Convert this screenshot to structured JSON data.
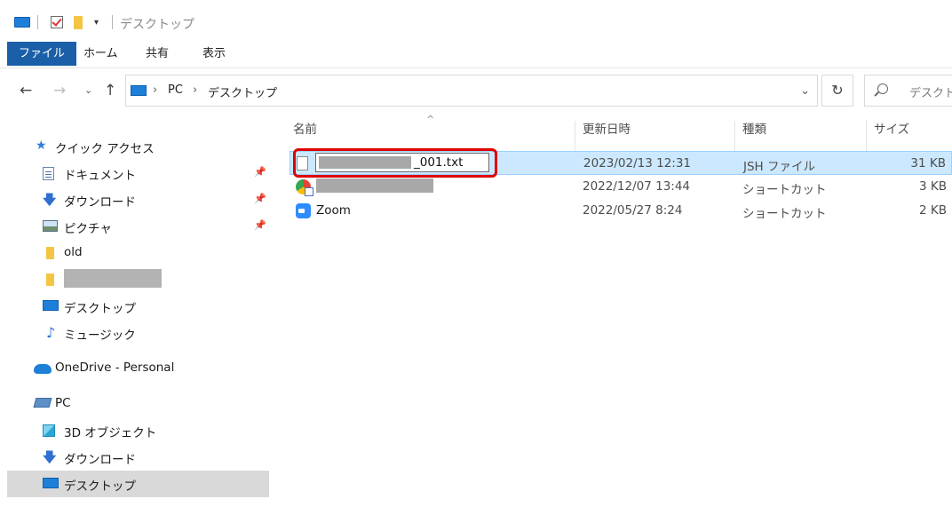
{
  "window": {
    "title": "デスクトップ"
  },
  "quick_access_toolbar": {
    "dropdown_glyph": "▾"
  },
  "ribbon": {
    "tabs": [
      "ファイル",
      "ホーム",
      "共有",
      "表示"
    ]
  },
  "nav": {
    "back": "←",
    "forward": "→",
    "recent": "⌄",
    "up": "↑",
    "breadcrumb": [
      "PC",
      "デスクトップ"
    ],
    "chevron": "›",
    "address_dropdown": "⌄",
    "refresh": "↻",
    "search_placeholder": "デスクトッ"
  },
  "navpane": {
    "quick_access": "クイック アクセス",
    "items": [
      {
        "label": "ドキュメント",
        "icon": "document-icon",
        "pinned": true
      },
      {
        "label": "ダウンロード",
        "icon": "download-icon",
        "pinned": true
      },
      {
        "label": "ピクチャ",
        "icon": "pictures-icon",
        "pinned": true
      },
      {
        "label": "old",
        "icon": "folder-icon",
        "pinned": false
      },
      {
        "label": "",
        "icon": "folder-icon",
        "pinned": false,
        "redacted": true
      },
      {
        "label": "デスクトップ",
        "icon": "desktop-icon",
        "pinned": false
      },
      {
        "label": "ミュージック",
        "icon": "music-icon",
        "pinned": false
      }
    ],
    "onedrive": "OneDrive - Personal",
    "pc": "PC",
    "pc_items": [
      {
        "label": "3D オブジェクト",
        "icon": "3d-objects-icon"
      },
      {
        "label": "ダウンロード",
        "icon": "download-icon"
      },
      {
        "label": "デスクトップ",
        "icon": "desktop-icon",
        "selected": true
      }
    ],
    "pin_glyph": "📌"
  },
  "file_list": {
    "sort_glyph": "^",
    "columns": [
      "名前",
      "更新日時",
      "種類",
      "サイズ"
    ],
    "rows": [
      {
        "name_suffix": "_001.txt",
        "date": "2023/02/13 12:31",
        "type": "JSH ファイル",
        "size": "31 KB",
        "renaming": true,
        "selected": true
      },
      {
        "name_suffix": "",
        "date": "2022/12/07 13:44",
        "type": "ショートカット",
        "size": "3 KB",
        "redacted": true
      },
      {
        "name": "Zoom",
        "date": "2022/05/27 8:24",
        "type": "ショートカット",
        "size": "2 KB"
      }
    ]
  }
}
